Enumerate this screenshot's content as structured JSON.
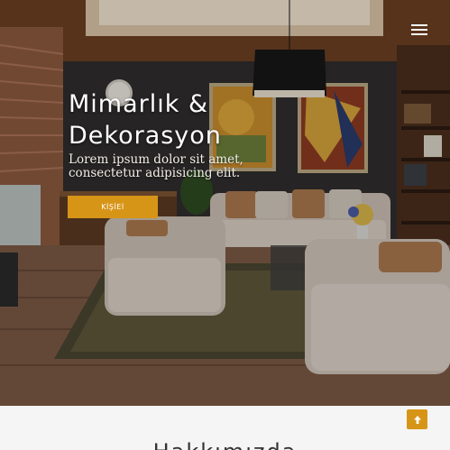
{
  "hero": {
    "title_line1": "Mimarlık &",
    "title_line2": "Dekorasyon",
    "subtitle": "Lorem ipsum dolor sit amet, consectetur adipisicing elit.",
    "button_label": "KİŞİEİ"
  },
  "section": {
    "heading": "Hakkımızda"
  },
  "colors": {
    "accent": "#d79518",
    "hero_text": "#ffffff"
  },
  "icons": {
    "menu": "hamburger-icon",
    "scroll_top": "arrow-up-icon"
  }
}
